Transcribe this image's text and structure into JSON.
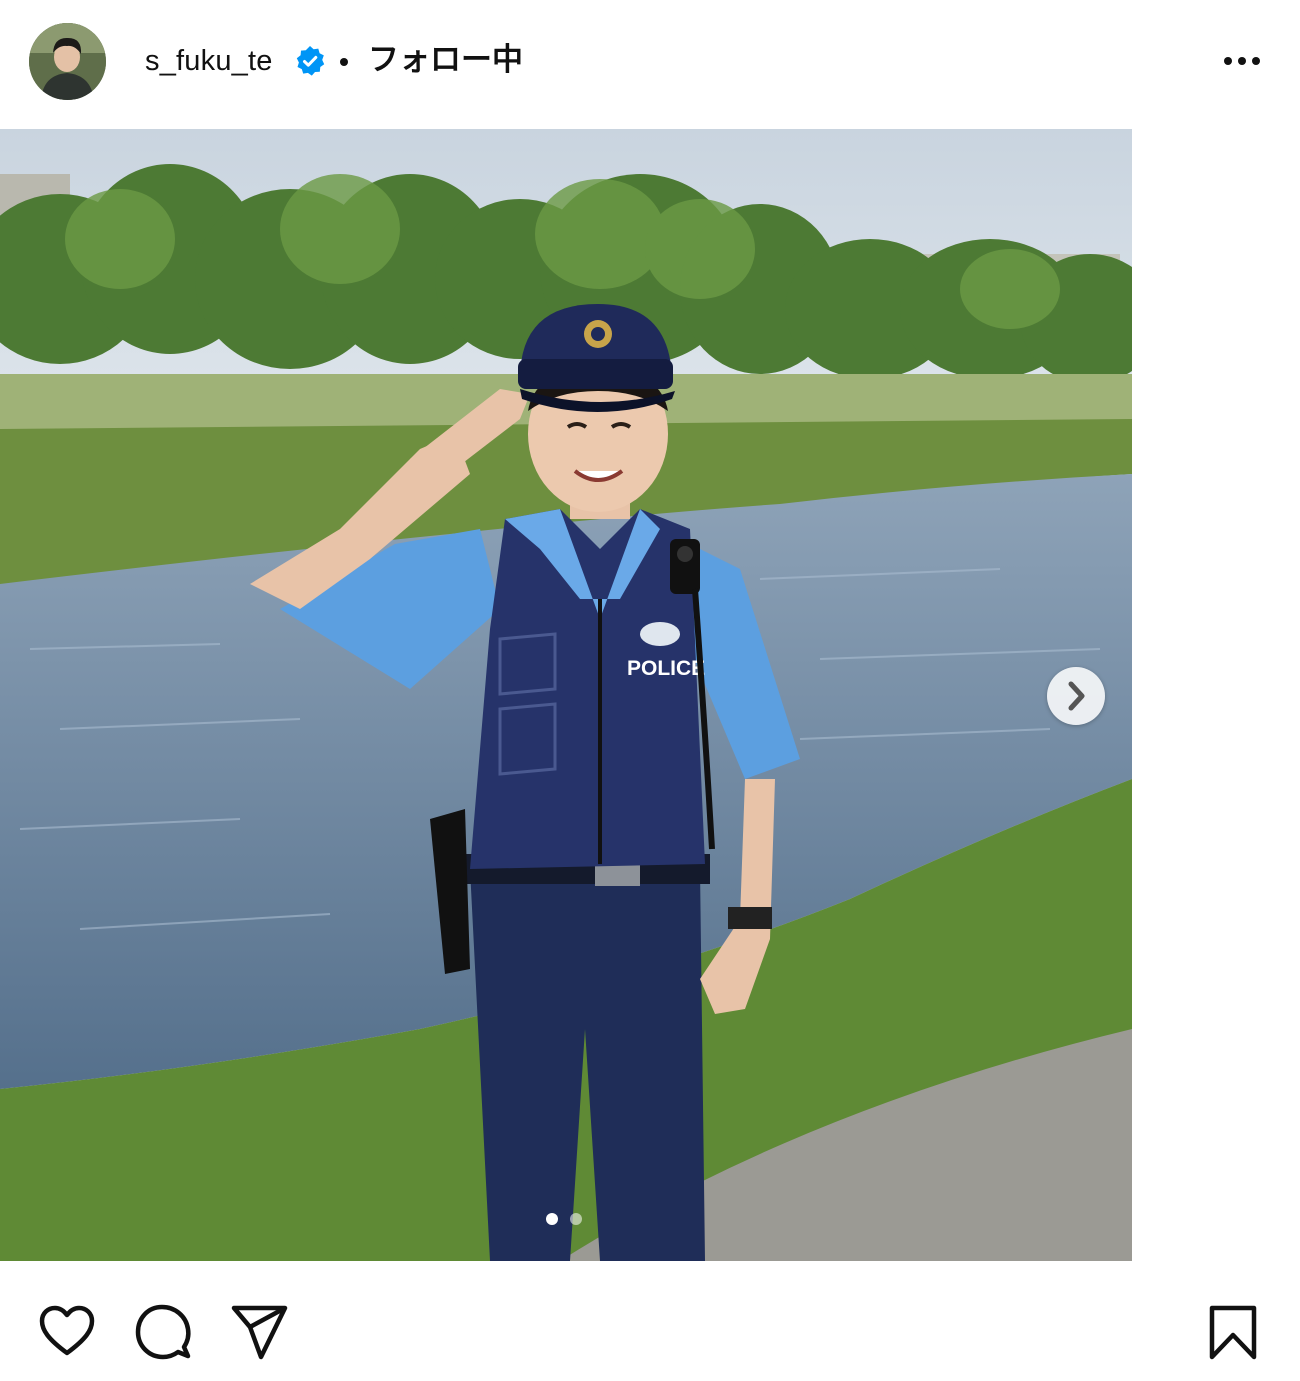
{
  "header": {
    "username": "s_fuku_te",
    "verified": true,
    "separator": "•",
    "follow_status": "フォロー中",
    "more_icon": "more-horizontal-icon"
  },
  "post": {
    "image_description_icon": "photo",
    "carousel": {
      "total_slides": 2,
      "current_slide": 1
    },
    "vest_text": "POLICE",
    "next_icon": "chevron-right-icon"
  },
  "actions": {
    "like_icon": "heart-icon",
    "comment_icon": "comment-icon",
    "share_icon": "send-icon",
    "save_icon": "bookmark-icon"
  },
  "colors": {
    "verified_blue": "#0095f6",
    "text": "#111111",
    "background": "#ffffff"
  }
}
